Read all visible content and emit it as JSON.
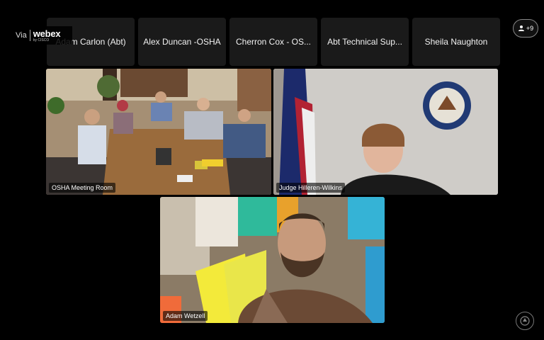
{
  "top_strip": [
    {
      "name": "Adam Carlon (Abt)"
    },
    {
      "name": "Alex Duncan -OSHA"
    },
    {
      "name": "Cherron Cox - OS..."
    },
    {
      "name": "Abt Technical Sup..."
    },
    {
      "name": "Sheila Naughton"
    }
  ],
  "brand": {
    "via": "Via",
    "logo": "webex",
    "sub": "by CISCO"
  },
  "participants_counter": {
    "label": "+9",
    "icon": "people-icon"
  },
  "tiles": [
    {
      "label": "OSHA Meeting Room"
    },
    {
      "label": "Judge Hilleren-Wilkins"
    },
    {
      "label": "Adam Wetzell"
    }
  ],
  "colors": {
    "background": "#000000",
    "tile_bg": "#1a1a1a"
  },
  "corner_icon": "seal-icon"
}
